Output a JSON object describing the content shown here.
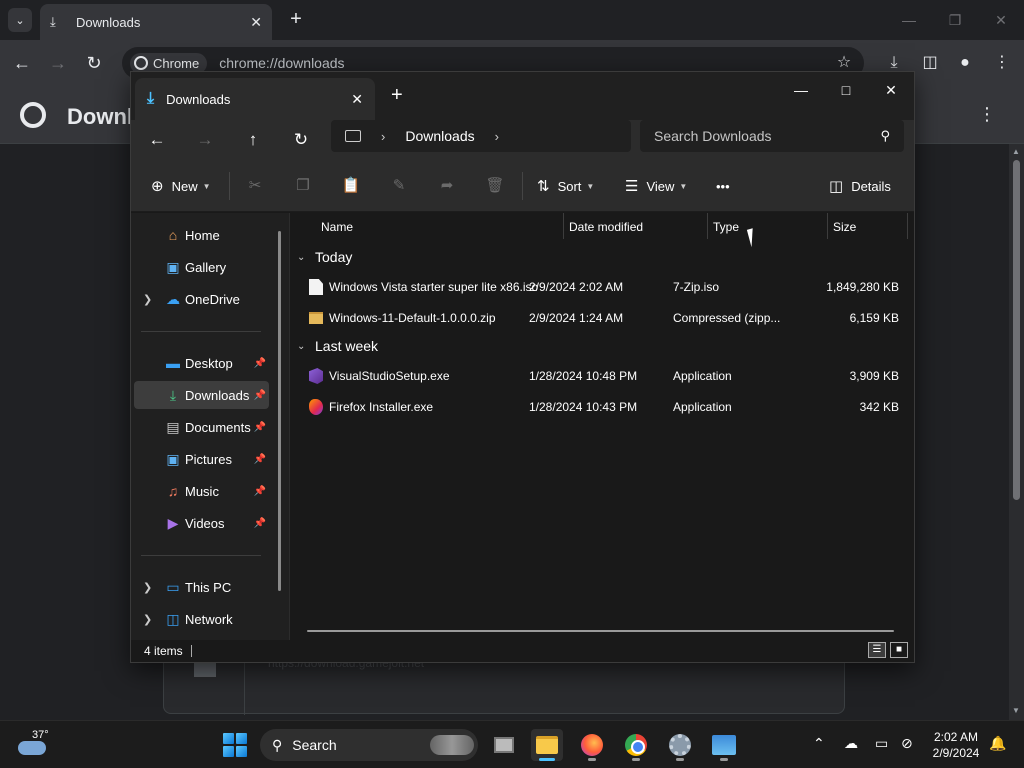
{
  "chrome": {
    "tab_title": "Downloads",
    "chip_label": "Chrome",
    "url": "chrome://downloads",
    "page_title": "Downlo",
    "card_url": "https://download.gamejolt.net"
  },
  "explorer": {
    "tab_title": "Downloads",
    "breadcrumb": "Downloads",
    "search_placeholder": "Search Downloads",
    "commands": {
      "new": "New",
      "sort": "Sort",
      "view": "View",
      "more": "•••",
      "details": "Details"
    },
    "nav": {
      "home": "Home",
      "gallery": "Gallery",
      "onedrive": "OneDrive",
      "desktop": "Desktop",
      "downloads": "Downloads",
      "documents": "Documents",
      "pictures": "Pictures",
      "music": "Music",
      "videos": "Videos",
      "thispc": "This PC",
      "network": "Network"
    },
    "columns": {
      "name": "Name",
      "date": "Date modified",
      "type": "Type",
      "size": "Size"
    },
    "groups": [
      {
        "title": "Today",
        "files": [
          {
            "name": "Windows Vista starter super lite x86.iso",
            "date": "2/9/2024 2:02 AM",
            "type": "7-Zip.iso",
            "size": "1,849,280 KB",
            "icon": "document-icon"
          },
          {
            "name": "Windows-11-Default-1.0.0.0.zip",
            "date": "2/9/2024 1:24 AM",
            "type": "Compressed (zipp...",
            "size": "6,159 KB",
            "icon": "zip-folder-icon"
          }
        ]
      },
      {
        "title": "Last week",
        "files": [
          {
            "name": "VisualStudioSetup.exe",
            "date": "1/28/2024 10:48 PM",
            "type": "Application",
            "size": "3,909 KB",
            "icon": "visual-studio-icon"
          },
          {
            "name": "Firefox Installer.exe",
            "date": "1/28/2024 10:43 PM",
            "type": "Application",
            "size": "342 KB",
            "icon": "firefox-icon"
          }
        ]
      }
    ],
    "status": "4 items"
  },
  "taskbar": {
    "temperature": "37°",
    "search_label": "Search",
    "time": "2:02 AM",
    "date": "2/9/2024"
  }
}
